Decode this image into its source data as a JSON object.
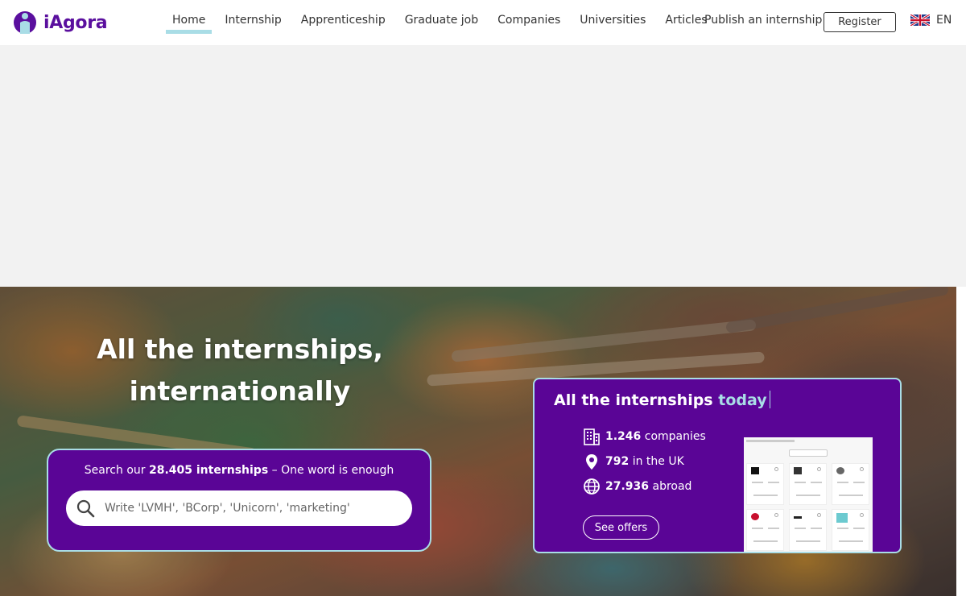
{
  "header": {
    "logo_text": "iAgora",
    "nav": [
      {
        "label": "Home",
        "active": true
      },
      {
        "label": "Internship",
        "active": false
      },
      {
        "label": "Apprenticeship",
        "active": false
      },
      {
        "label": "Graduate job",
        "active": false
      },
      {
        "label": "Companies",
        "active": false
      },
      {
        "label": "Universities",
        "active": false
      },
      {
        "label": "Articles",
        "active": false
      }
    ],
    "publish_label": "Publish an internship",
    "register_label": "Register",
    "language": "EN",
    "language_flag_icon": "uk-flag-icon"
  },
  "hero": {
    "title": "All the internships, internationally",
    "search": {
      "label_prefix": "Search our",
      "label_count": "28.405 internships",
      "label_suffix": "– One word is enough",
      "placeholder": "Write 'LVMH', 'BCorp', 'Unicorn', 'marketing'"
    },
    "stats": {
      "title_main": "All the internships",
      "title_accent": "today",
      "rows": [
        {
          "icon": "building-icon",
          "value": "1.246",
          "label": "companies"
        },
        {
          "icon": "location-pin-icon",
          "value": "792",
          "label": "in the UK"
        },
        {
          "icon": "globe-icon",
          "value": "27.936",
          "label": "abroad"
        }
      ],
      "cta_label": "See offers"
    }
  },
  "colors": {
    "brand_purple": "#5a0596",
    "accent_cyan": "#a9dde6",
    "logo_purple": "#5a0f9e"
  }
}
